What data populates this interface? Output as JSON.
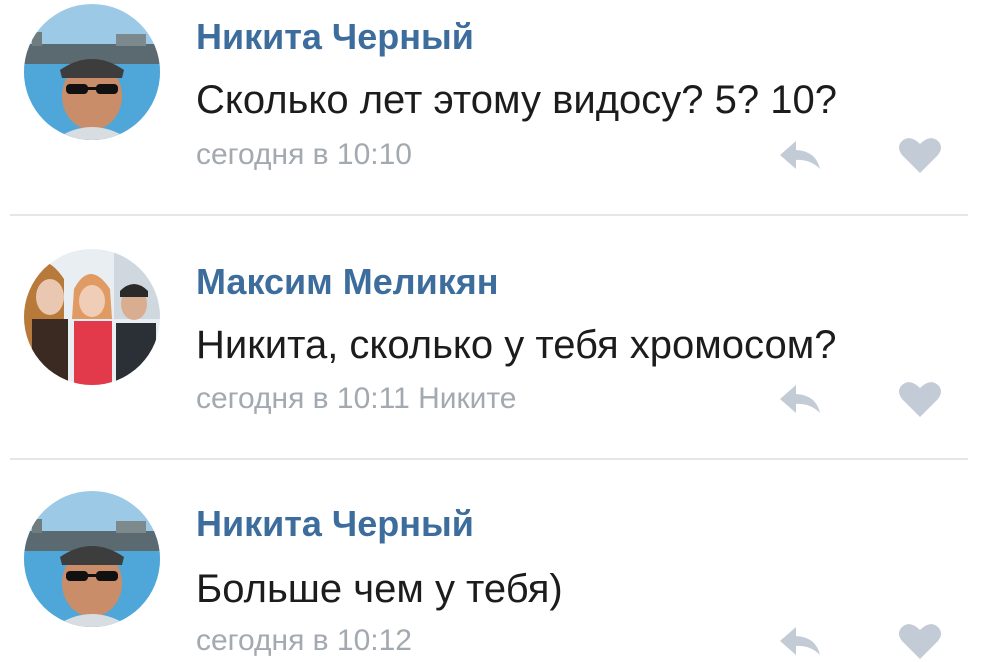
{
  "comments": [
    {
      "author": "Никита Черный",
      "text": "Сколько лет этому видосу? 5? 10?",
      "meta": "сегодня в 10:10",
      "avatar": "avatar-man-sunglasses"
    },
    {
      "author": "Максим Меликян",
      "text": "Никита, сколько у тебя хромосом?",
      "meta": "сегодня в 10:11 Никите",
      "avatar": "avatar-group-photo"
    },
    {
      "author": "Никита Черный",
      "text": "Больше чем у тебя)",
      "meta": "сегодня в 10:12",
      "avatar": "avatar-man-sunglasses"
    }
  ],
  "icons": {
    "reply": "reply-arrow-icon",
    "like": "heart-icon"
  },
  "colors": {
    "author": "#3d6d9c",
    "text": "#1c1c1c",
    "meta": "#a3a9b1",
    "icon": "#c3ccd6",
    "divider": "#e4e6ea"
  }
}
